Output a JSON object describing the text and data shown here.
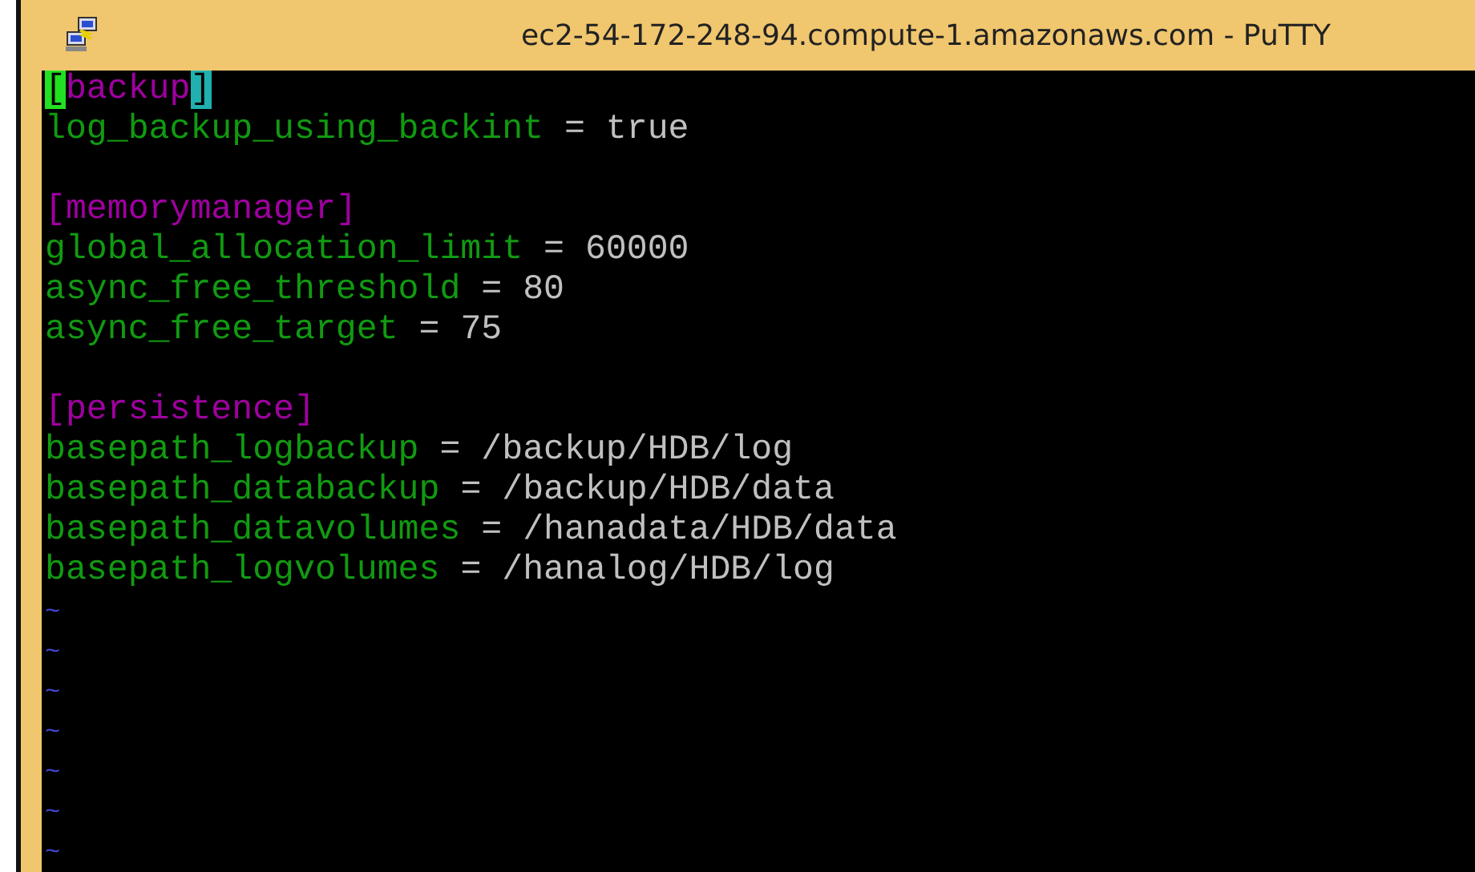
{
  "window": {
    "title": "ec2-54-172-248-94.compute-1.amazonaws.com - PuTTY"
  },
  "terminal": {
    "lines": [
      {
        "kind": "section",
        "open": "[",
        "name": "backup",
        "close": "]",
        "highlighted": true
      },
      {
        "kind": "setting",
        "key": "log_backup_using_backint",
        "op": "=",
        "value": "true"
      },
      {
        "kind": "blank"
      },
      {
        "kind": "section",
        "open": "[",
        "name": "memorymanager",
        "close": "]",
        "highlighted": false
      },
      {
        "kind": "setting",
        "key": "global_allocation_limit",
        "op": "=",
        "value": "60000"
      },
      {
        "kind": "setting",
        "key": "async_free_threshold",
        "op": "=",
        "value": "80"
      },
      {
        "kind": "setting",
        "key": "async_free_target",
        "op": "=",
        "value": "75"
      },
      {
        "kind": "blank"
      },
      {
        "kind": "section",
        "open": "[",
        "name": "persistence",
        "close": "]",
        "highlighted": false
      },
      {
        "kind": "setting",
        "key": "basepath_logbackup",
        "op": "=",
        "value": "/backup/HDB/log"
      },
      {
        "kind": "setting",
        "key": "basepath_databackup",
        "op": "=",
        "value": "/backup/HDB/data"
      },
      {
        "kind": "setting",
        "key": "basepath_datavolumes",
        "op": "=",
        "value": "/hanadata/HDB/data"
      },
      {
        "kind": "setting",
        "key": "basepath_logvolumes",
        "op": "=",
        "value": "/hanalog/HDB/log"
      },
      {
        "kind": "tilde",
        "text": "~"
      },
      {
        "kind": "tilde",
        "text": "~"
      },
      {
        "kind": "tilde",
        "text": "~"
      },
      {
        "kind": "tilde",
        "text": "~"
      },
      {
        "kind": "tilde",
        "text": "~"
      },
      {
        "kind": "tilde",
        "text": "~"
      },
      {
        "kind": "tilde",
        "text": "~"
      }
    ]
  }
}
